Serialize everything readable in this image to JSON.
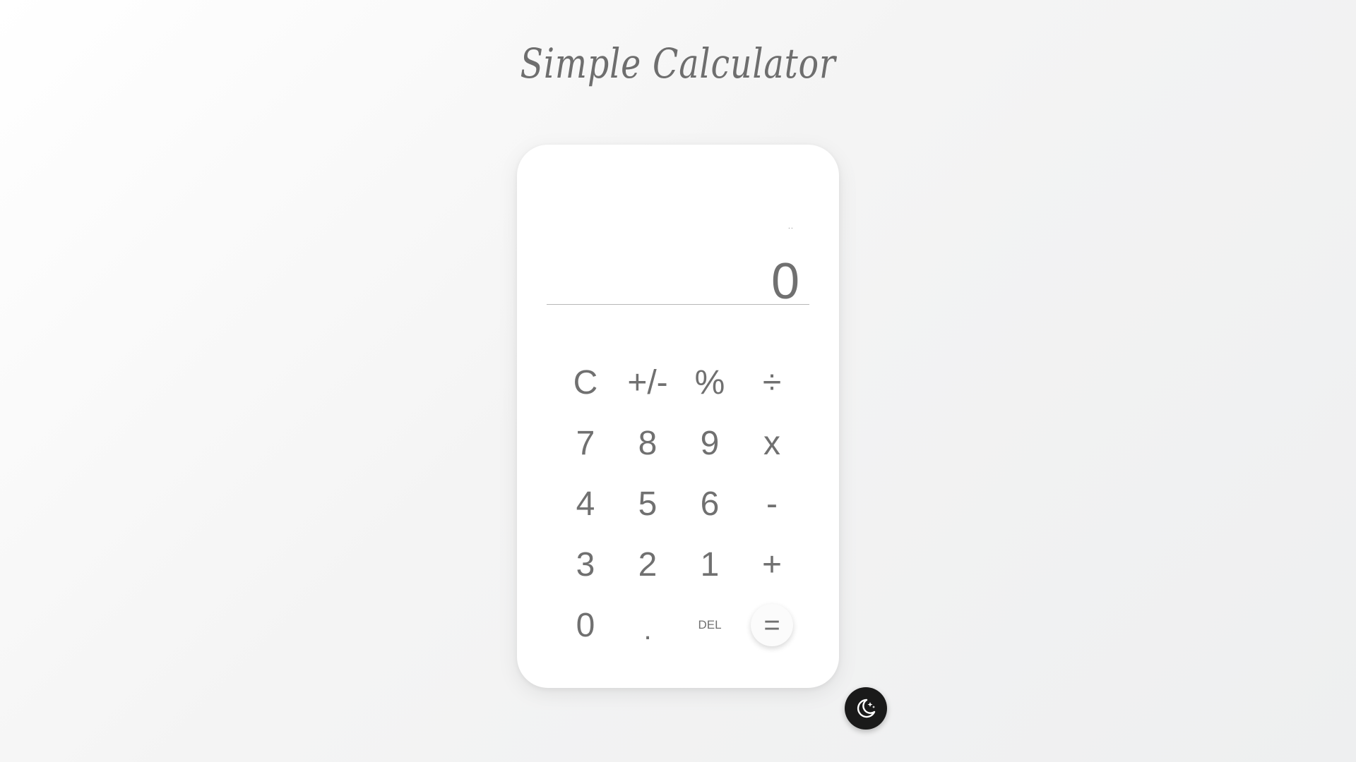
{
  "page": {
    "title": "Simple Calculator"
  },
  "display": {
    "history": "..",
    "result": "0"
  },
  "keys": [
    {
      "label": "C",
      "name": "clear-button"
    },
    {
      "label": "+/-",
      "name": "sign-toggle-button"
    },
    {
      "label": "%",
      "name": "percent-button"
    },
    {
      "label": "÷",
      "name": "divide-button"
    },
    {
      "label": "7",
      "name": "digit-7-button"
    },
    {
      "label": "8",
      "name": "digit-8-button"
    },
    {
      "label": "9",
      "name": "digit-9-button"
    },
    {
      "label": "x",
      "name": "multiply-button"
    },
    {
      "label": "4",
      "name": "digit-4-button"
    },
    {
      "label": "5",
      "name": "digit-5-button"
    },
    {
      "label": "6",
      "name": "digit-6-button"
    },
    {
      "label": "-",
      "name": "subtract-button"
    },
    {
      "label": "3",
      "name": "digit-3-button"
    },
    {
      "label": "2",
      "name": "digit-2-button"
    },
    {
      "label": "1",
      "name": "digit-1-button"
    },
    {
      "label": "+",
      "name": "add-button"
    },
    {
      "label": "0",
      "name": "digit-0-button"
    },
    {
      "label": ".",
      "name": "decimal-button"
    },
    {
      "label": "DEL",
      "name": "delete-button"
    },
    {
      "label": "=",
      "name": "equals-button"
    }
  ],
  "theme_toggle": {
    "icon": "moon-stars-icon",
    "color": "#1a1a1a"
  },
  "colors": {
    "text": "#707070",
    "card": "#ffffff"
  }
}
